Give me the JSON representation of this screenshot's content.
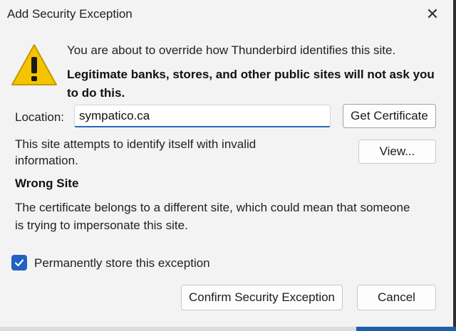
{
  "dialog": {
    "title": "Add Security Exception",
    "close_symbol": "✕"
  },
  "warning": {
    "icon": "warning-triangle-icon",
    "message": "You are about to override how Thunderbird identifies this site.",
    "bold_message": "Legitimate banks, stores, and other public sites will not ask you to do this."
  },
  "location": {
    "label": "Location:",
    "value": "sympatico.ca"
  },
  "buttons": {
    "get_certificate": "Get Certificate",
    "view": "View...",
    "confirm": "Confirm Security Exception",
    "cancel": "Cancel"
  },
  "status": {
    "info": "This site attempts to identify itself with invalid information.",
    "heading": "Wrong Site",
    "detail": "The certificate belongs to a different site, which could mean that someone is trying to impersonate this site."
  },
  "permanent": {
    "label": "Permanently store this exception",
    "checked": true
  },
  "colors": {
    "accent": "#1f62c4",
    "warning_yellow": "#f5c400"
  }
}
